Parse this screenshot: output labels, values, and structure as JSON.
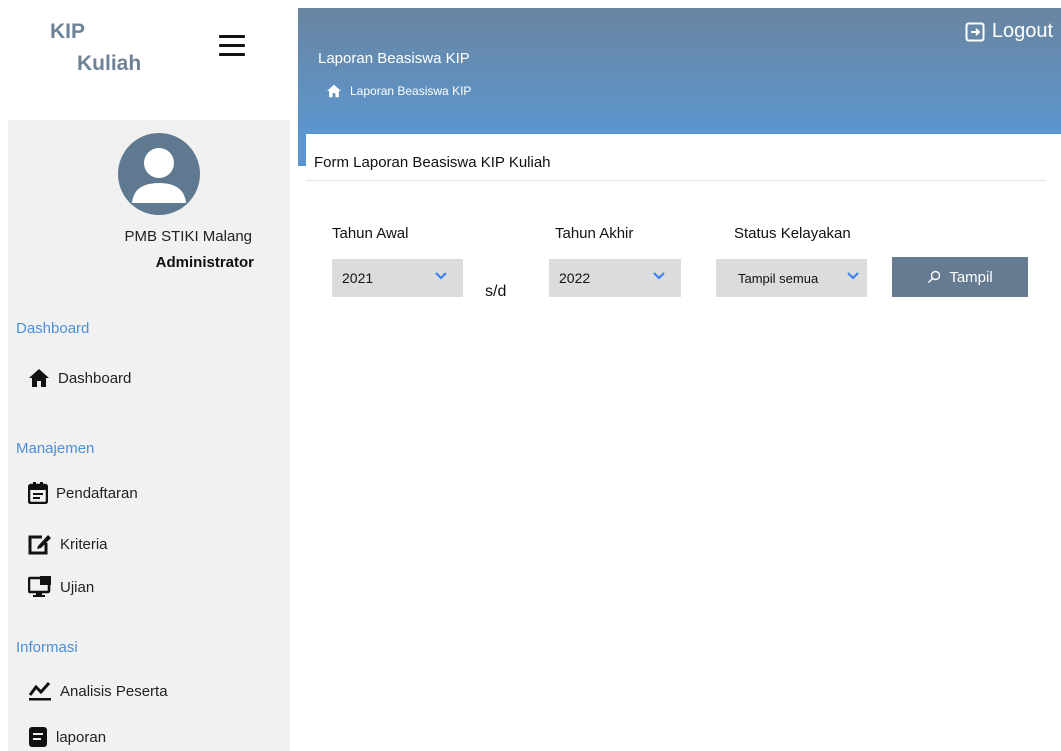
{
  "brand": {
    "line1": "KIP",
    "line2": "Kuliah"
  },
  "profile": {
    "name": "PMB STIKI Malang",
    "role": "Administrator"
  },
  "sidebar": {
    "sections": [
      {
        "label": "Dashboard"
      },
      {
        "label": "Manajemen"
      },
      {
        "label": "Informasi"
      }
    ],
    "items": [
      {
        "label": "Dashboard",
        "icon": "home-icon"
      },
      {
        "label": "Pendaftaran",
        "icon": "calendar-icon"
      },
      {
        "label": "Kriteria",
        "icon": "edit-icon"
      },
      {
        "label": "Ujian",
        "icon": "monitor-icon"
      },
      {
        "label": "Analisis Peserta",
        "icon": "chart-line-icon"
      },
      {
        "label": "laporan",
        "icon": "document-icon"
      }
    ]
  },
  "header": {
    "title": "Laporan Beasiswa KIP",
    "breadcrumb": "Laporan Beasiswa KIP",
    "logout_label": "Logout"
  },
  "form": {
    "title": "Form Laporan Beasiswa KIP Kuliah",
    "tahun_awal": {
      "label": "Tahun Awal",
      "value": "2021"
    },
    "separator": "s/d",
    "tahun_akhir": {
      "label": "Tahun Akhir",
      "value": "2022"
    },
    "status": {
      "label": "Status Kelayakan",
      "value": "Tampil semua"
    },
    "submit_label": "Tampil"
  },
  "colors": {
    "accent": "#5b96cf",
    "header_top": "#6a85a0",
    "section_label": "#4a90d9",
    "button": "#647b91",
    "select_bg": "#dcdcdc",
    "sidebar_bg": "#f1f1f1"
  }
}
